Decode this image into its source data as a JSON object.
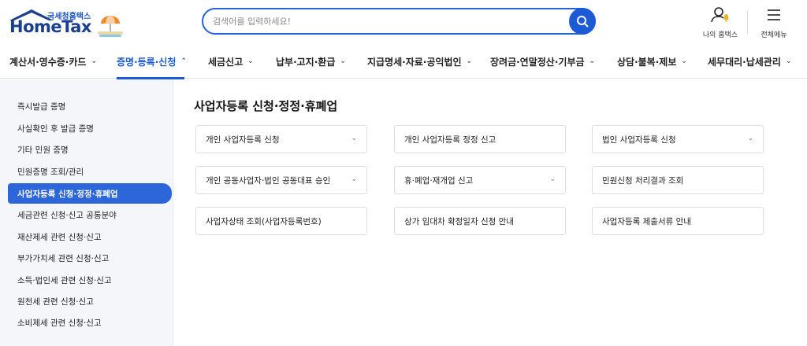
{
  "logo": {
    "subtitle": "국세청홈택스",
    "title": "HomeTax"
  },
  "search": {
    "placeholder": "검색어를 입력하세요!"
  },
  "utility": {
    "my_hometax": "나의 홈택스",
    "all_menu": "전체메뉴"
  },
  "nav": {
    "items": [
      {
        "label": "계산서·영수증·카드"
      },
      {
        "label": "증명·등록·신청"
      },
      {
        "label": "세금신고"
      },
      {
        "label": "납부·고지·환급"
      },
      {
        "label": "지급명세·자료·공익법인"
      },
      {
        "label": "장려금·연말정산·기부금"
      },
      {
        "label": "상담·불복·제보"
      },
      {
        "label": "세무대리·납세관리"
      }
    ],
    "active_index": 1
  },
  "sidebar": {
    "items": [
      {
        "label": "즉시발급 증명"
      },
      {
        "label": "사실확인 후 발급 증명"
      },
      {
        "label": "기타 민원 증명"
      },
      {
        "label": "민원증명 조회/관리"
      },
      {
        "label": "사업자등록 신청·정정·휴폐업"
      },
      {
        "label": "세금관련 신청·신고 공통분야"
      },
      {
        "label": "재산제세 관련 신청·신고"
      },
      {
        "label": "부가가치세 관련 신청·신고"
      },
      {
        "label": "소득·법인세 관련 신청·신고"
      },
      {
        "label": "원천세 관련 신청·신고"
      },
      {
        "label": "소비제세 관련 신청·신고"
      }
    ],
    "active_index": 4
  },
  "main": {
    "title": "사업자등록 신청·정정·휴폐업",
    "cards": [
      {
        "label": "개인 사업자등록 신청",
        "has_dropdown": true
      },
      {
        "label": "개인 사업자등록 정정 신고",
        "has_dropdown": false
      },
      {
        "label": "법인 사업자등록 신청",
        "has_dropdown": true
      },
      {
        "label": "개인 공동사업자·법인 공동대표 승인",
        "has_dropdown": true
      },
      {
        "label": "휴·폐업·재개업 신고",
        "has_dropdown": true
      },
      {
        "label": "민원신청 처리결과 조회",
        "has_dropdown": false
      },
      {
        "label": "사업자상태 조회(사업자등록번호)",
        "has_dropdown": false
      },
      {
        "label": "상가 임대차 확정일자 신청 안내",
        "has_dropdown": false
      },
      {
        "label": "사업자등록 제출서류 안내",
        "has_dropdown": false
      }
    ]
  },
  "colors": {
    "accent": "#1d5bd6",
    "sidebar_bg": "#f4f6f9",
    "active_sidebar": "#2c66d9"
  },
  "icons": [
    "search-icon",
    "my-hometax-icon",
    "menu-icon",
    "chevron-down-icon",
    "chevron-up-icon"
  ]
}
